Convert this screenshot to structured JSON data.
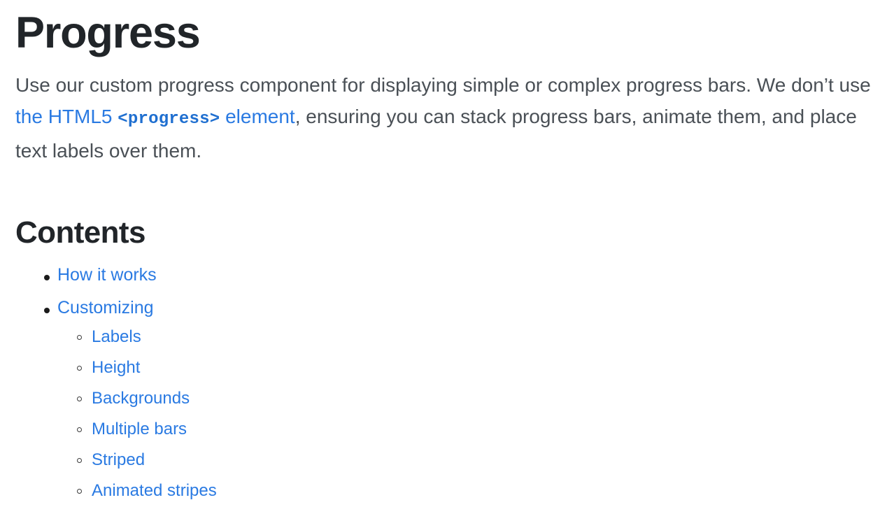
{
  "page": {
    "title": "Progress",
    "intro": {
      "before_link": "Use our custom progress component for displaying simple or complex progress bars. We don’t use ",
      "link_prefix": "the HTML5 ",
      "link_code": "<progress>",
      "link_suffix": " element",
      "after_link": ", ensuring you can stack progress bars, animate them, and place text labels over them."
    },
    "contents": {
      "heading": "Contents",
      "items": [
        {
          "label": "How it works",
          "children": []
        },
        {
          "label": "Customizing",
          "children": [
            {
              "label": "Labels"
            },
            {
              "label": "Height"
            },
            {
              "label": "Backgrounds"
            },
            {
              "label": "Multiple bars"
            },
            {
              "label": "Striped"
            },
            {
              "label": "Animated stripes"
            }
          ]
        }
      ]
    }
  },
  "colors": {
    "heading": "#212529",
    "body_text": "#4a5056",
    "link": "#2a7ae2",
    "code": "#1f6fd0",
    "background": "#ffffff",
    "bullet": "#1b1b1b"
  }
}
